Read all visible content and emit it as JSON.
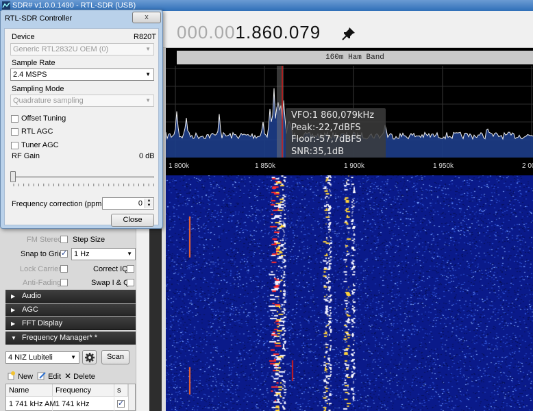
{
  "app": {
    "title": "SDR# v1.0.0.1490 - RTL-SDR (USB)",
    "frequency_dim": "000.00",
    "frequency_lit": "1.860.079"
  },
  "spectrum": {
    "band_label": "160m Ham Band",
    "tooltip": {
      "vfo": "VFO:1 860,079kHz",
      "peak": "Peak:-22,7dBFS",
      "floor": "Floor:-57,7dBFS",
      "snr": "SNR:35,1dB"
    },
    "axis_labels": [
      "1 800k",
      "1 850k",
      "1 900k",
      "1 950k",
      "2 00"
    ]
  },
  "dialog": {
    "title": "RTL-SDR Controller",
    "close_x": "x",
    "device_label": "Device",
    "device_tuner": "R820T",
    "device_value": "Generic RTL2832U OEM (0)",
    "sample_rate_label": "Sample Rate",
    "sample_rate_value": "2.4 MSPS",
    "sampling_mode_label": "Sampling Mode",
    "sampling_mode_value": "Quadrature sampling",
    "offset_tuning": "Offset Tuning",
    "rtl_agc": "RTL AGC",
    "tuner_agc": "Tuner AGC",
    "rf_gain_label": "RF Gain",
    "rf_gain_value": "0 dB",
    "freq_corr_label": "Frequency correction (ppm)",
    "freq_corr_value": "0",
    "close_button": "Close"
  },
  "panel": {
    "fm_stereo": "FM Stereo",
    "step_size": "Step Size",
    "snap_to_grid": "Snap to Grid",
    "step_value": "1 Hz",
    "lock_carrier": "Lock Carrier",
    "correct_iq": "Correct IQ",
    "anti_fading": "Anti-Fading",
    "swap_iq": "Swap I & Q",
    "sections": [
      "Audio",
      "AGC",
      "FFT Display",
      "Frequency Manager* *"
    ],
    "group_value": "4 NIZ Lubiteli",
    "scan": "Scan",
    "new": "New",
    "edit": "Edit",
    "delete": "Delete",
    "grid_headers": [
      "Name",
      "Frequency",
      "s"
    ],
    "grid_row": [
      "1 741 kHz AM",
      "1 741 kHz"
    ]
  },
  "colors": {
    "spectrum_bg": "#000000",
    "spectrum_fill": "#1d3d8a",
    "vfo_line": "#d11a1a",
    "waterfall_bg": "#0a1a8a"
  }
}
